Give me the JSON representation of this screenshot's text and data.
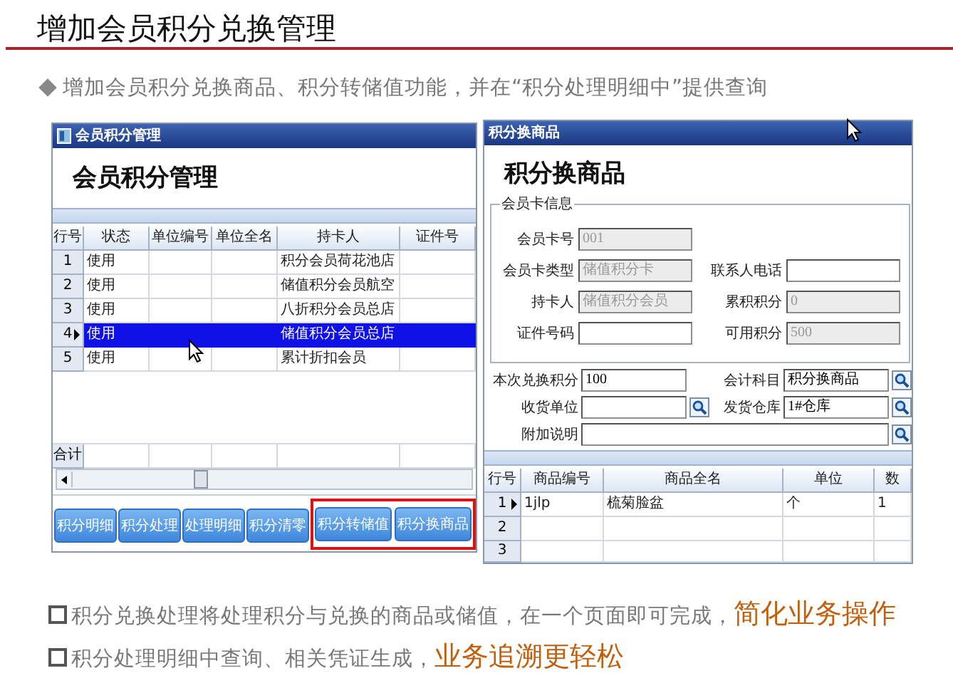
{
  "title": "增加会员积分兑换管理",
  "intro": "增加会员积分兑换商品、积分转储值功能，并在“积分处理明细中”提供查询",
  "left_window": {
    "titlebar": "会员积分管理",
    "heading": "会员积分管理",
    "table": {
      "columns": [
        "行号",
        "状态",
        "单位编号",
        "单位全名",
        "持卡人",
        "证件号"
      ],
      "rows": [
        {
          "number": "1",
          "status": "使用",
          "cardholder": "积分会员荷花池店",
          "selected": false
        },
        {
          "number": "2",
          "status": "使用",
          "cardholder": "储值积分会员航空",
          "selected": false
        },
        {
          "number": "3",
          "status": "使用",
          "cardholder": "八折积分会员总店",
          "selected": false
        },
        {
          "number": "4",
          "status": "使用",
          "cardholder": "储值积分会员总店",
          "selected": true
        },
        {
          "number": "5",
          "status": "使用",
          "cardholder": "累计折扣会员",
          "selected": false
        }
      ],
      "total_label": "合计"
    },
    "buttons": [
      {
        "label": "积分明细",
        "highlighted": false
      },
      {
        "label": "积分处理",
        "highlighted": false
      },
      {
        "label": "处理明细",
        "highlighted": false
      },
      {
        "label": "积分清零",
        "highlighted": false
      },
      {
        "label": "积分转储值",
        "highlighted": true
      },
      {
        "label": "积分换商品",
        "highlighted": true
      }
    ]
  },
  "right_window": {
    "titlebar": "积分换商品",
    "heading": "积分换商品",
    "card_info": {
      "legend": "会员卡信息",
      "rows": [
        [
          {
            "label": "会员卡号",
            "value": "001",
            "readonly": true
          }
        ],
        [
          {
            "label": "会员卡类型",
            "value": "储值积分卡",
            "readonly": true
          },
          {
            "label": "联系人电话",
            "readonly": false
          }
        ],
        [
          {
            "label": "持卡人",
            "value": "储值积分会员",
            "readonly": true
          },
          {
            "label": "累积积分",
            "value": "0",
            "readonly": true
          }
        ],
        [
          {
            "label": "证件号码",
            "readonly": false
          },
          {
            "label": "可用积分",
            "value": "500",
            "readonly": true
          }
        ]
      ]
    },
    "exchange": {
      "rows": [
        [
          {
            "label": "本次兑换积分",
            "value": "100",
            "lookup": false
          },
          {
            "label": "会计科目",
            "value": "积分换商品",
            "lookup": true
          }
        ],
        [
          {
            "label": "收货单位",
            "lookup": true
          },
          {
            "label": "发货仓库",
            "value": "1#仓库",
            "lookup": true
          }
        ],
        [
          {
            "label": "附加说明",
            "lookup": true
          }
        ]
      ]
    },
    "goods_table": {
      "columns": [
        "行号",
        "商品编号",
        "商品全名",
        "单位",
        "数"
      ],
      "rows": [
        {
          "number": "1",
          "code": "1jlp",
          "name": "梳菊脸盆",
          "unit": "个",
          "quantity": "1",
          "current": true
        },
        {
          "number": "2",
          "current": false
        },
        {
          "number": "3",
          "current": false
        }
      ]
    }
  },
  "notes": [
    {
      "text": "积分兑换处理将处理积分与兑换的商品或储值，在一个页面即可完成，",
      "emphasis": "简化业务操作"
    },
    {
      "text": "积分处理明细中查询、相关凭证生成，",
      "emphasis": "业务追溯更轻松"
    }
  ]
}
